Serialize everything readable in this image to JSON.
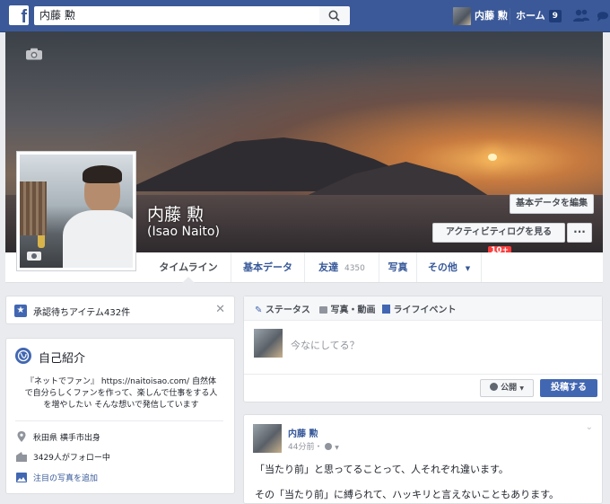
{
  "topbar": {
    "search_value": "内藤 勲",
    "user_name": "内藤 勲",
    "home_label": "ホーム",
    "home_count": "9"
  },
  "profile": {
    "name_jp": "内藤 勲",
    "name_en": "(Isao Naito)",
    "edit_basic_info": "基本データを編集",
    "activity_log": "アクティビティログを見る",
    "activity_badge": "10+"
  },
  "tabs": [
    {
      "label": "タイムライン"
    },
    {
      "label": "基本データ"
    },
    {
      "label": "友達",
      "count": "4350"
    },
    {
      "label": "写真"
    },
    {
      "label": "その他"
    }
  ],
  "pending": {
    "label": "承認待ちアイテム432件"
  },
  "intro": {
    "title": "自己紹介",
    "bio": "『ネットでファン』 https://naitoisao.com/ 自然体で自分らしくファンを作って、楽しんで仕事をする人を増やしたい そんな想いで発信しています",
    "location": "秋田県 横手市出身",
    "followers": "3429人がフォロー中",
    "add_photos": "注目の写真を追加"
  },
  "composer": {
    "tab_status": "ステータス",
    "tab_photo": "写真・動画",
    "tab_life": "ライフイベント",
    "placeholder": "今なにしてる？",
    "privacy": "公開",
    "post_button": "投稿する"
  },
  "post": {
    "author": "内藤 勲",
    "time": "44分前・",
    "line1": "「当たり前」と思ってることって、人それぞれ違います。",
    "line2": "その「当たり前」に縛られて、ハッキリと言えないこともあります。"
  },
  "colors": {
    "brand": "#3b5998",
    "link": "#365899",
    "button_blue": "#4267b2",
    "badge_red": "#fa3e3e"
  }
}
